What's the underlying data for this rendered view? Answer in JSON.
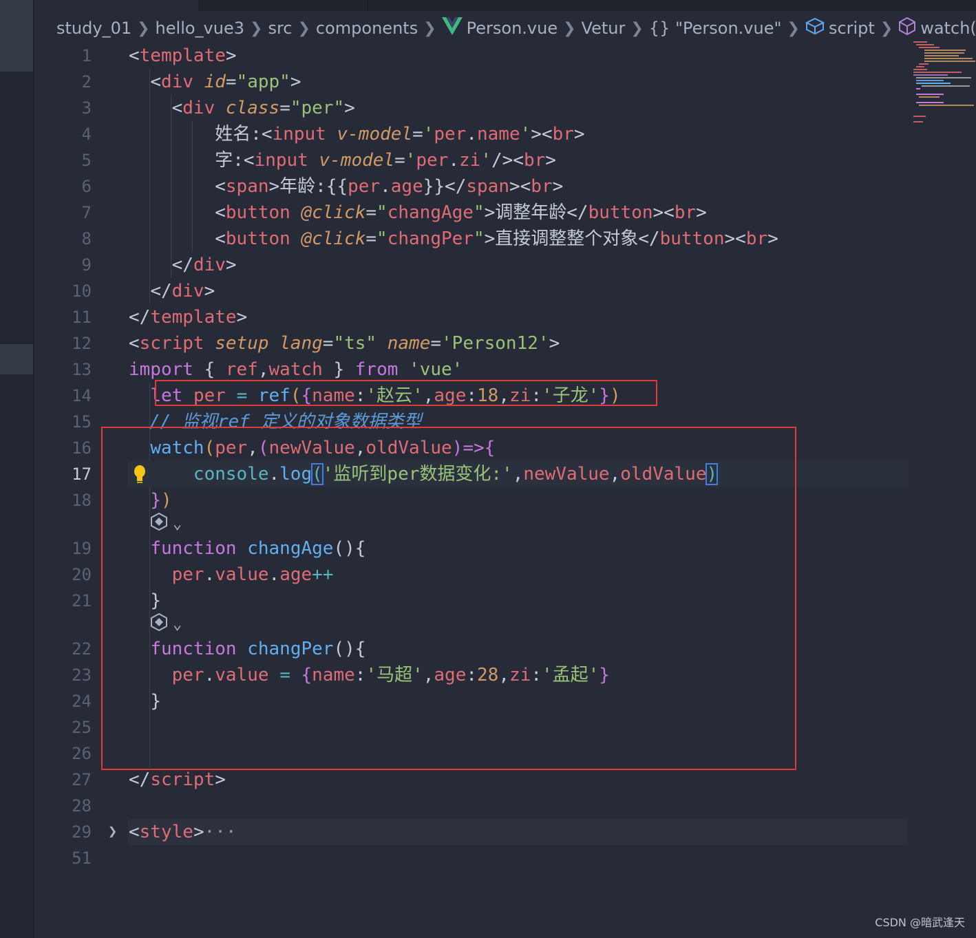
{
  "breadcrumb": [
    "study_01",
    "hello_vue3",
    "src",
    "components",
    "Person.vue",
    "Vetur",
    "{} \"Person.vue\"",
    "script",
    "watch() callback"
  ],
  "watermark": "CSDN @暗武逢天",
  "colors": {
    "red_box": "#e03a3a",
    "background": "#262b37",
    "bracket_highlight": "#3f7fe0"
  },
  "icons": {
    "vue": "vue-logo-icon",
    "script": "cube-outline-icon",
    "watch": "cube-icon",
    "codelens": "ai-sparkle-icon",
    "lightbulb": "lightbulb-icon",
    "fold": "chevron-right-icon"
  },
  "lines": {
    "n1": "1",
    "n2": "2",
    "n3": "3",
    "n4": "4",
    "n5": "5",
    "n6": "6",
    "n7": "7",
    "n8": "8",
    "n9": "9",
    "n10": "10",
    "n11": "11",
    "n12": "12",
    "n13": "13",
    "n14": "14",
    "n15": "15",
    "n16": "16",
    "n17": "17",
    "n18": "18",
    "n19": "19",
    "n20": "20",
    "n21": "21",
    "n22": "22",
    "n23": "23",
    "n24": "24",
    "n25": "25",
    "n26": "26",
    "n27": "27",
    "n28": "28",
    "n29": "29",
    "n51": "51"
  },
  "code": {
    "l4_label": "姓名:",
    "l5_label": "字:",
    "l6_text": "年龄:",
    "l7_text": "调整年龄",
    "l8_text": "直接调整整个对象",
    "l14_name1": "'赵云'",
    "l14_zi1": "'子龙'",
    "l15_comment": "// 监视ref 定义的对象数据类型",
    "l17_str": "'监听到per数据变化:'",
    "l23_name": "'马超'",
    "l23_zi": "'孟起'",
    "l29_ellipsis": "···"
  }
}
